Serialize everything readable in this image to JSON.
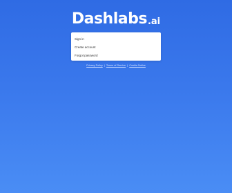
{
  "brand": {
    "name": "Dashlabs",
    "suffix": ".ai"
  },
  "menu": {
    "items": [
      {
        "label": "Sign in"
      },
      {
        "label": "Create account"
      },
      {
        "label": "Forgot password"
      }
    ]
  },
  "footer": {
    "links": [
      {
        "label": "Privacy Policy"
      },
      {
        "label": "Terms of Service"
      },
      {
        "label": "Cookie Notice"
      }
    ],
    "separator": "|"
  },
  "colors": {
    "background_top": "#2f6be4",
    "background_bottom": "#4a8df5",
    "card": "#ffffff",
    "text": "#333333"
  }
}
